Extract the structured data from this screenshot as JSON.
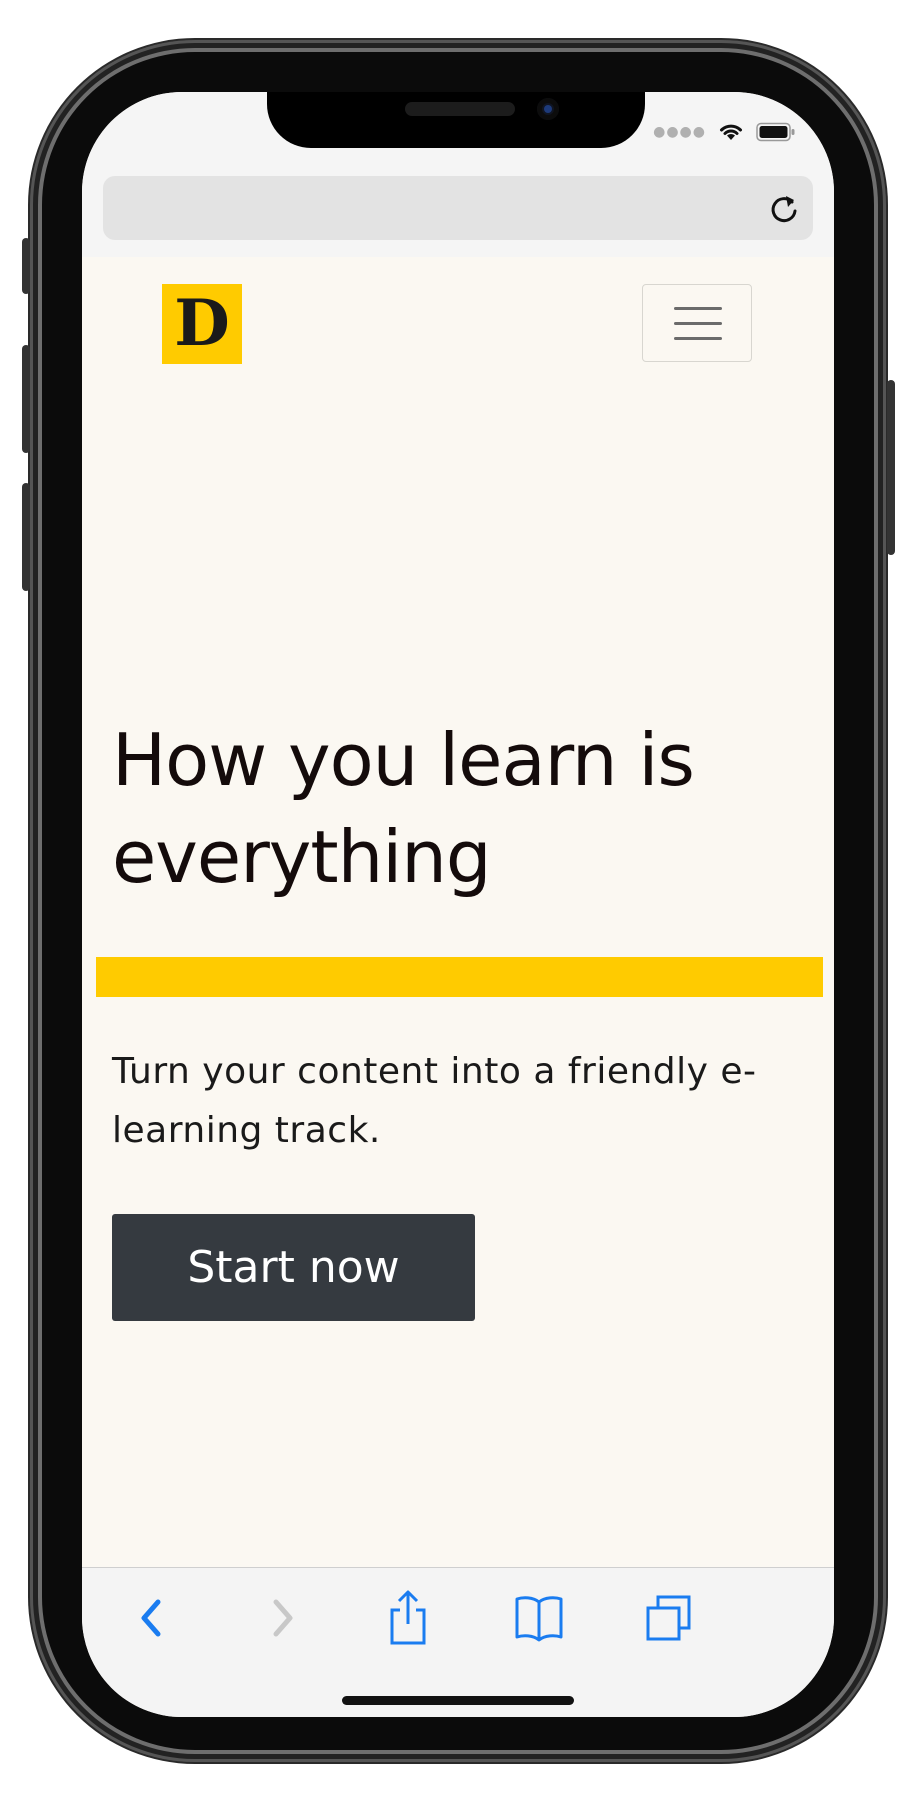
{
  "status_bar": {
    "signal_icon": "signal-dots-icon",
    "wifi_icon": "wifi-icon",
    "battery_icon": "battery-icon"
  },
  "url_bar": {
    "reload_icon": "reload-icon"
  },
  "header": {
    "logo_text": "D",
    "logo_color": "#ffcb00",
    "menu_icon": "hamburger-icon"
  },
  "hero": {
    "title": "How you learn is everything",
    "subtitle": "Turn your content into a friendly e-learning track.",
    "cta_label": "Start now",
    "highlight_color": "#ffcb00",
    "cta_color": "#353a40"
  },
  "toolbar": {
    "items": [
      "back-icon",
      "forward-icon",
      "share-icon",
      "bookmarks-icon",
      "tabs-icon"
    ],
    "accent_color": "#1a7cf0"
  }
}
